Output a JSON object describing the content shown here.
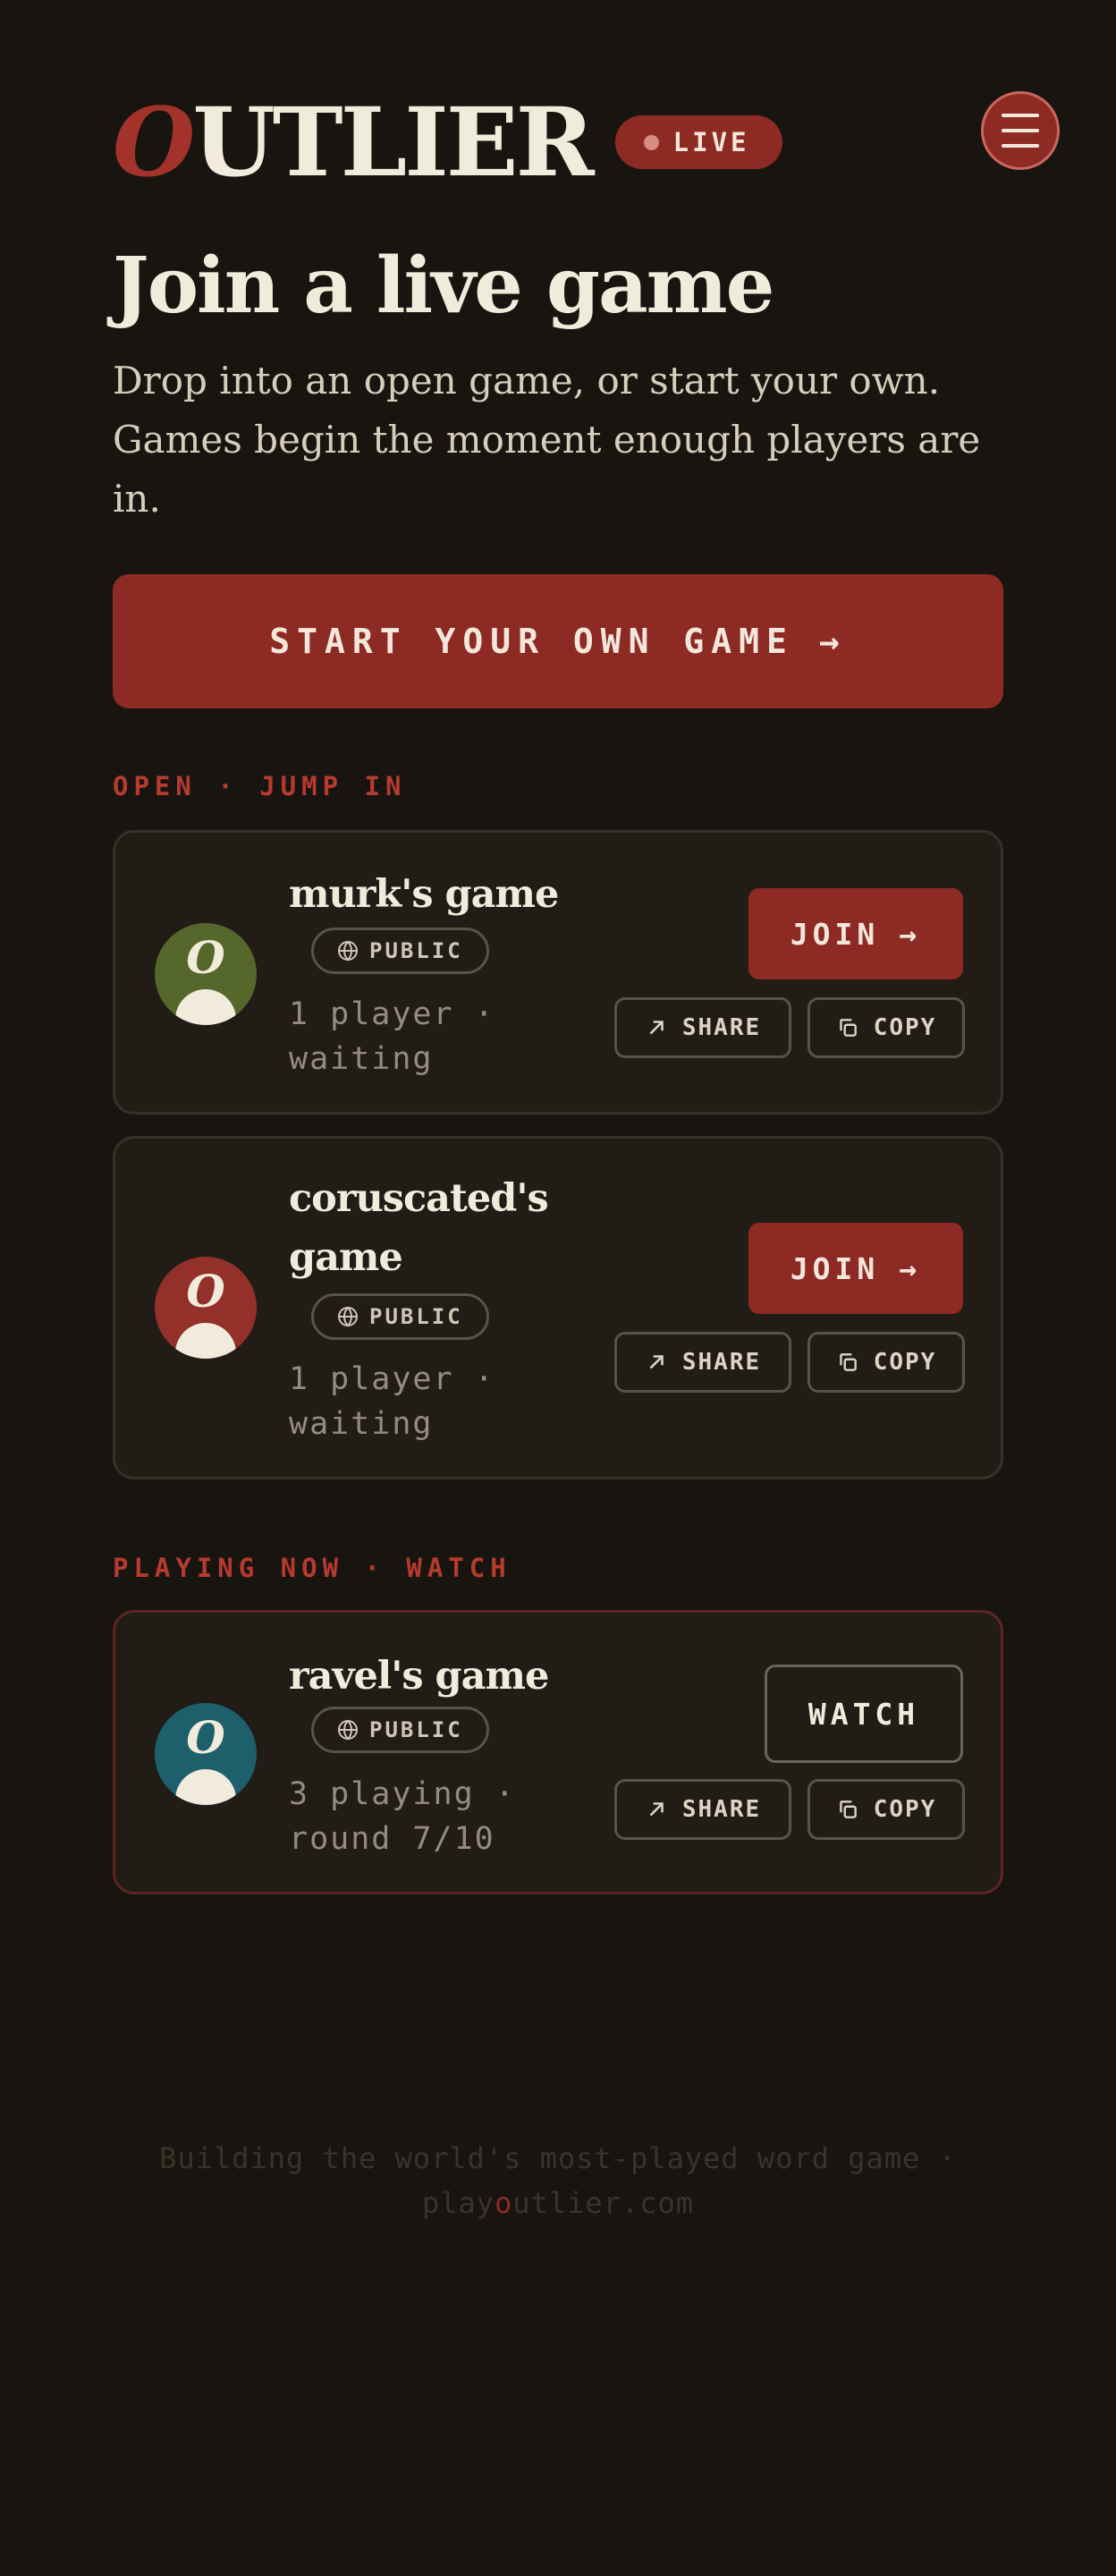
{
  "header": {
    "logo_first_letter": "O",
    "logo_rest": "UTLIER",
    "live_label": "LIVE",
    "menu_icon": "hamburger-menu-icon"
  },
  "hero": {
    "title": "Join a live game",
    "subtitle": "Drop into an open game, or start your own. Games begin the moment enough players are in.",
    "cta_label": "START YOUR OWN GAME",
    "cta_arrow": "→"
  },
  "sections": {
    "open_label": "OPEN · JUMP IN",
    "playing_label": "PLAYING NOW · WATCH"
  },
  "open_games": [
    {
      "name": "murk's game",
      "visibility": "PUBLIC",
      "status": "1 player · waiting",
      "action_label": "JOIN",
      "action_arrow": "→",
      "share_label": "SHARE",
      "copy_label": "COPY",
      "avatar_letter": "O",
      "avatar_color": "#55672a"
    },
    {
      "name": "coruscated's game",
      "visibility": "PUBLIC",
      "status": "1 player · waiting",
      "action_label": "JOIN",
      "action_arrow": "→",
      "share_label": "SHARE",
      "copy_label": "COPY",
      "avatar_letter": "O",
      "avatar_color": "#93302a"
    }
  ],
  "playing_games": [
    {
      "name": "ravel's game",
      "visibility": "PUBLIC",
      "status": "3 playing · round 7/10",
      "action_label": "WATCH",
      "share_label": "SHARE",
      "copy_label": "COPY",
      "avatar_letter": "O",
      "avatar_color": "#1d5f6b"
    }
  ],
  "footer": {
    "tagline": "Building the world's most-played word game ·",
    "domain_prefix": "play",
    "domain_accent": "o",
    "domain_suffix": "utlier.com"
  },
  "colors": {
    "background": "#181511",
    "accent": "#8e2a24",
    "card": "#221c17",
    "text": "#f1ebdc"
  }
}
